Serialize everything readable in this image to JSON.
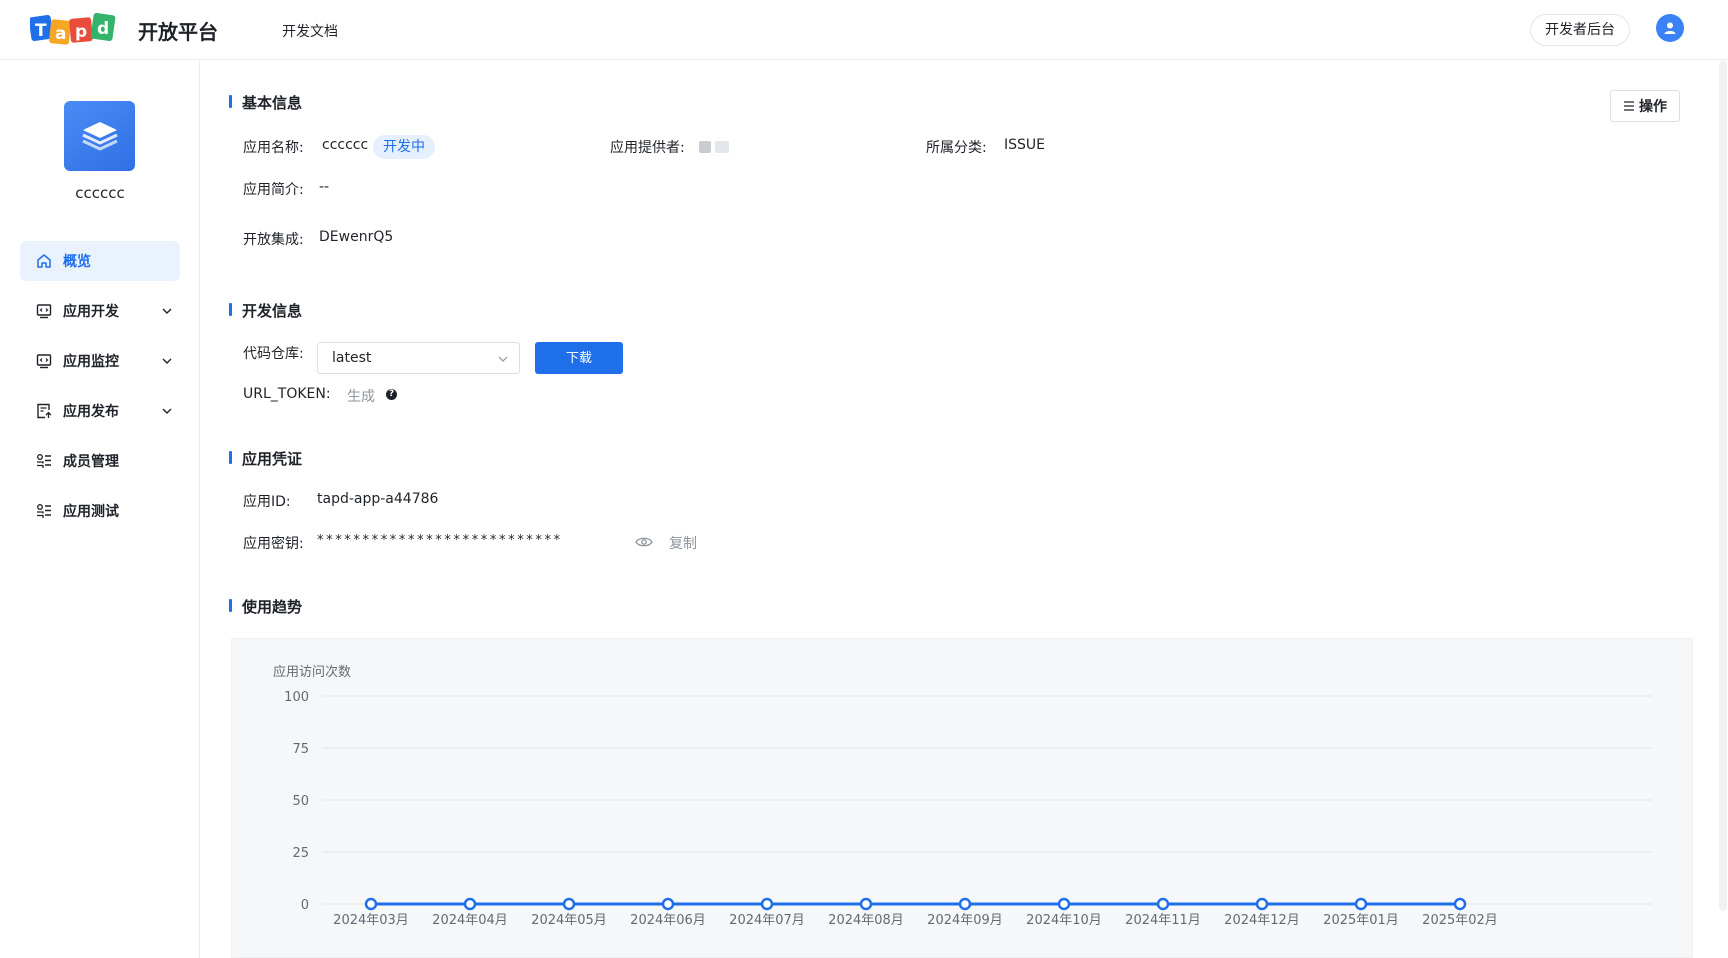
{
  "header": {
    "brand_title": "开放平台",
    "nav_docs": "开发文档",
    "dev_console": "开发者后台",
    "logo_text": "Tapd",
    "colors": {
      "primary": "#1f6feb"
    }
  },
  "sidebar": {
    "app_name": "cccccc",
    "items": [
      {
        "label": "概览",
        "icon": "home-icon",
        "active": true,
        "expandable": false
      },
      {
        "label": "应用开发",
        "icon": "monitor-code-icon",
        "active": false,
        "expandable": true
      },
      {
        "label": "应用监控",
        "icon": "monitor-code-icon",
        "active": false,
        "expandable": true
      },
      {
        "label": "应用发布",
        "icon": "publish-icon",
        "active": false,
        "expandable": true
      },
      {
        "label": "成员管理",
        "icon": "member-list-icon",
        "active": false,
        "expandable": false
      },
      {
        "label": "应用测试",
        "icon": "member-list-icon",
        "active": false,
        "expandable": false
      }
    ]
  },
  "main": {
    "ops_button": "操作",
    "basic": {
      "title": "基本信息",
      "name_label": "应用名称:",
      "name_value": "cccccc",
      "status_tag": "开发中",
      "provider_label": "应用提供者:",
      "category_label": "所属分类:",
      "category_value": "ISSUE",
      "intro_label": "应用简介:",
      "intro_value": "--",
      "integration_label": "开放集成:",
      "integration_value": "DEwenrQ5"
    },
    "dev": {
      "title": "开发信息",
      "repo_label": "代码仓库:",
      "repo_selected": "latest",
      "download_button": "下载",
      "url_token_label": "URL_TOKEN:",
      "generate_link": "生成",
      "help_glyph": "?"
    },
    "cred": {
      "title": "应用凭证",
      "id_label": "应用ID:",
      "id_value": "tapd-app-a44786",
      "secret_label": "应用密钥:",
      "secret_value": "***************************",
      "copy_link": "复制"
    },
    "trend": {
      "title": "使用趋势"
    }
  },
  "chart_data": {
    "type": "line",
    "ylabel": "应用访问次数",
    "categories": [
      "2024年03月",
      "2024年04月",
      "2024年05月",
      "2024年06月",
      "2024年07月",
      "2024年08月",
      "2024年09月",
      "2024年10月",
      "2024年11月",
      "2024年12月",
      "2025年01月",
      "2025年02月"
    ],
    "values": [
      0,
      0,
      0,
      0,
      0,
      0,
      0,
      0,
      0,
      0,
      0,
      0
    ],
    "yticks": [
      0,
      25,
      50,
      75,
      100
    ],
    "ylim": [
      0,
      100
    ],
    "grid": true,
    "color": "#1f6feb"
  }
}
